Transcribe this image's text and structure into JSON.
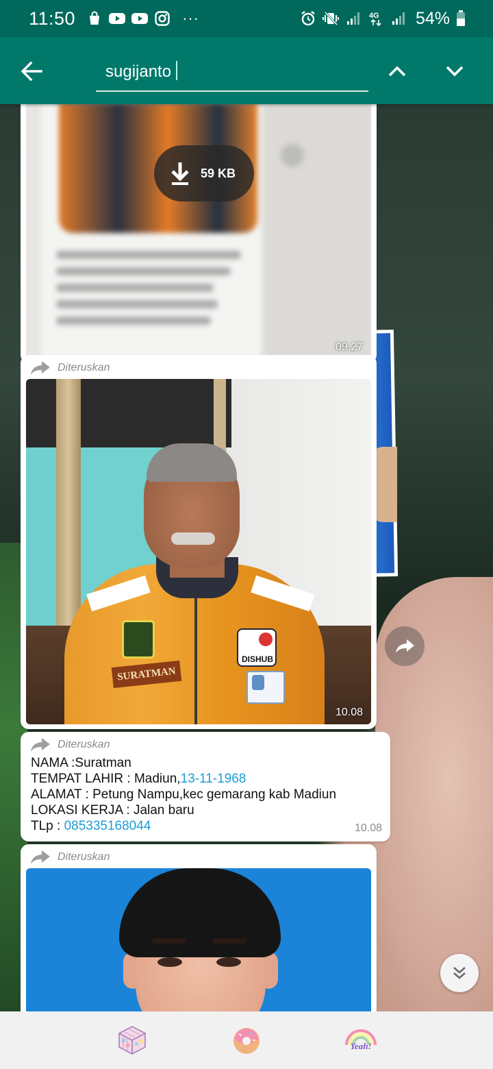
{
  "status_bar": {
    "time": "11:50",
    "left_icons": [
      "shopping-bag-icon",
      "youtube-icon",
      "youtube-icon",
      "instagram-icon"
    ],
    "more": "···",
    "right_icons": [
      "alarm-icon",
      "vibrate-icon",
      "signal-icon",
      "4g-icon",
      "signal-icon",
      "battery-icon"
    ],
    "network_label": "4G",
    "battery_percent": "54%"
  },
  "search": {
    "query": "sugijanto"
  },
  "messages": [
    {
      "type": "media-blurred",
      "download_size": "59 KB",
      "time": "09.27"
    },
    {
      "type": "photo",
      "forwarded_label": "Diteruskan",
      "name_patch": "SURATMAN",
      "badge_text": "DISHUB",
      "time": "10.08"
    },
    {
      "type": "text",
      "forwarded_label": "Diteruskan",
      "line1": "NAMA :Suratman",
      "line2_prefix": "TEMPAT LAHIR : Madiun,",
      "line2_link": "13-11-1968",
      "line3": "ALAMAT : Petung Nampu,kec gemarang kab Madiun",
      "line4": "LOKASI KERJA : Jalan baru",
      "line5_prefix": "TLp : ",
      "line5_link": "085335168044",
      "time": "10.08"
    },
    {
      "type": "photo",
      "forwarded_label": "Diteruskan"
    }
  ],
  "bottom_bar": {
    "items": [
      "rubiks-cube-icon",
      "donut-icon",
      "rainbow-yeah-icon"
    ],
    "rainbow_text": "Yeah!"
  },
  "colors": {
    "toolbar": "#00796b",
    "status_bar": "#00695c",
    "link": "#1d9bd6"
  }
}
